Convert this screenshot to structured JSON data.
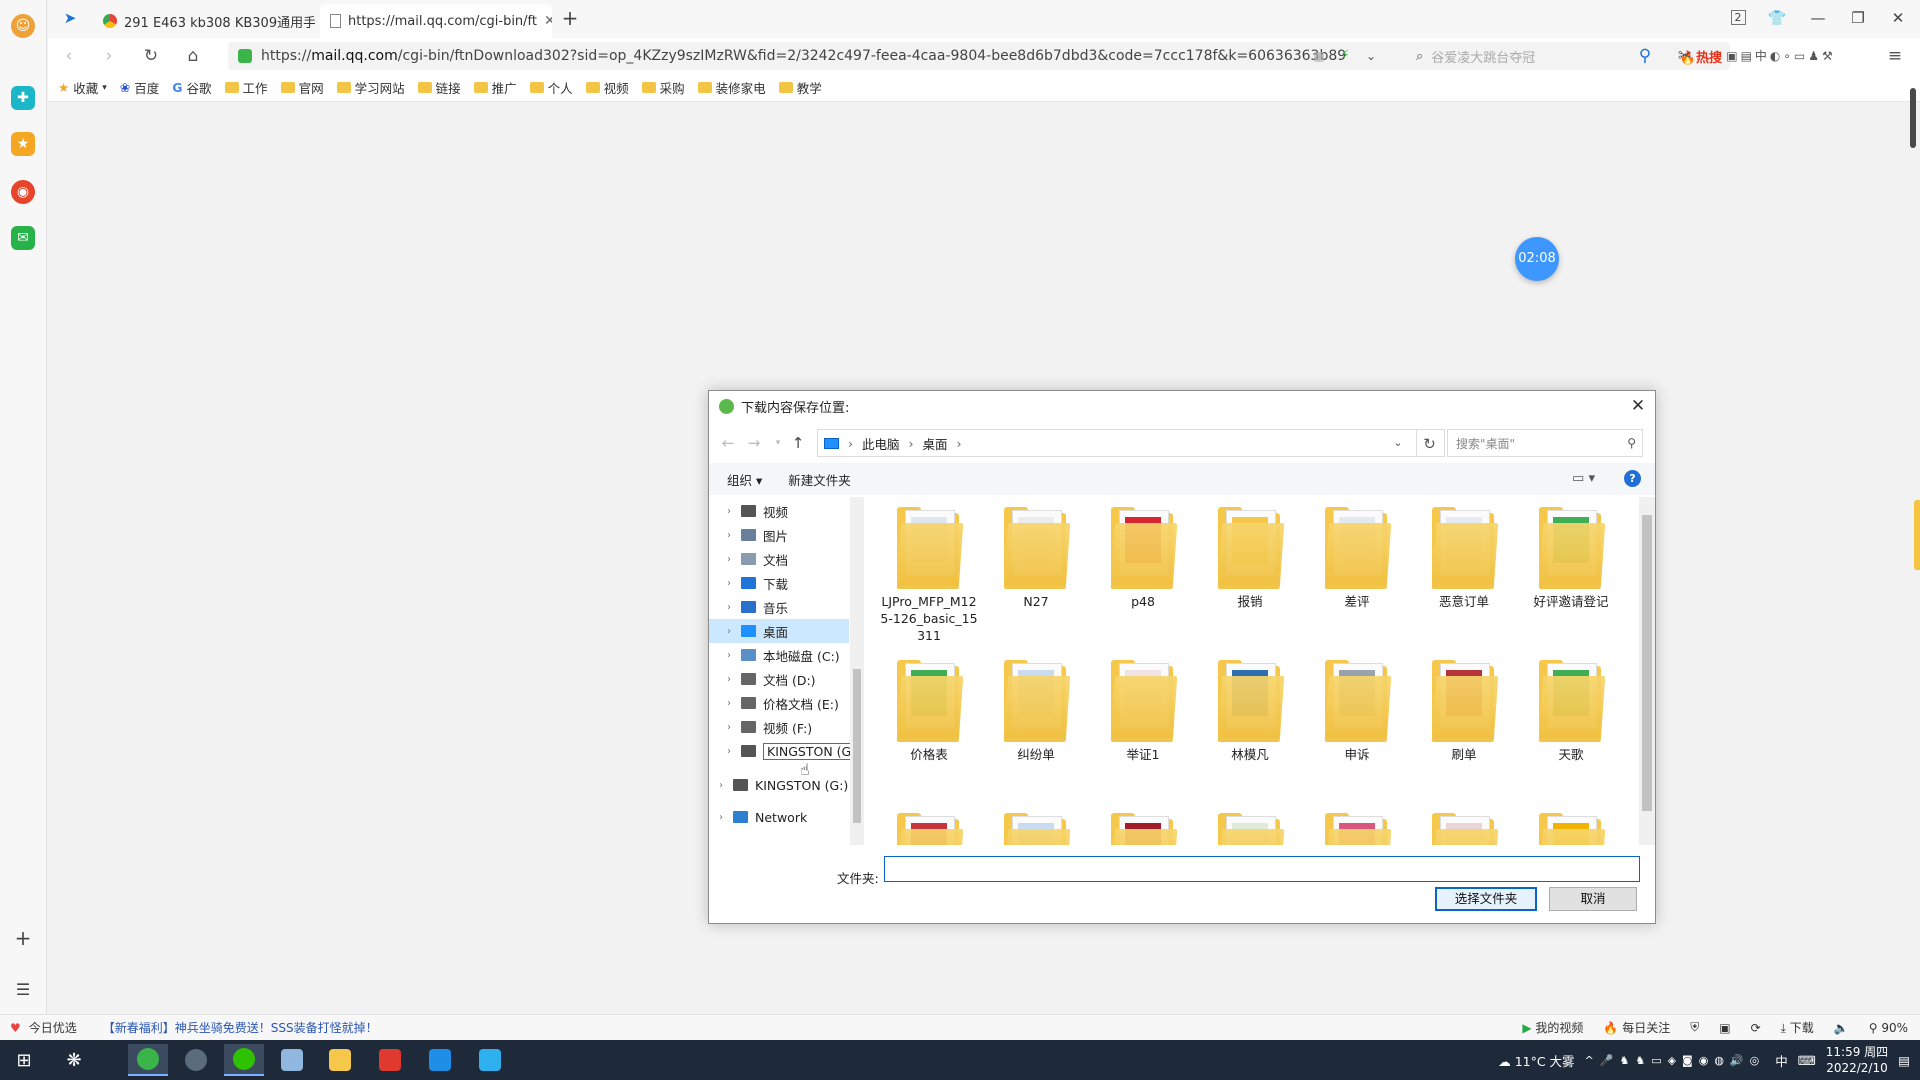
{
  "tabs": [
    {
      "label": "291 E463 kb308 KB309通用手",
      "active": false
    },
    {
      "label": "https://mail.qq.com/cgi-bin/ft",
      "active": true
    }
  ],
  "window": {
    "badge": "2"
  },
  "address": {
    "scheme": "https://",
    "host": "mail.qq.com",
    "path": "/cgi-bin/ftnDownload302?sid=op_4KZzy9szIMzRW&fid=2/3242c497-feea-4caa-9804-bee8d6b7dbd3&code=7ccc178f&k=60636363b89"
  },
  "search": {
    "placeholder": "谷爱凌大跳台夺冠",
    "hot": "🔥热搜"
  },
  "bookmarks": [
    "收藏",
    "百度",
    "谷歌",
    "工作",
    "官网",
    "学习网站",
    "链接",
    "推广",
    "个人",
    "视频",
    "采购",
    "装修家电",
    "教学"
  ],
  "timer": "02:08",
  "dialog": {
    "title": "下载内容保存位置:",
    "breadcrumb": [
      "此电脑",
      "桌面"
    ],
    "search_placeholder": "搜索\"桌面\"",
    "organize": "组织 ▾",
    "new_folder": "新建文件夹",
    "help": "?",
    "tree": [
      {
        "label": "视频",
        "color": "#555555"
      },
      {
        "label": "图片",
        "color": "#6a7f99"
      },
      {
        "label": "文档",
        "color": "#8a9bb0"
      },
      {
        "label": "下载",
        "color": "#1f74d6"
      },
      {
        "label": "音乐",
        "color": "#2a6fc9"
      },
      {
        "label": "桌面",
        "color": "#1e90ff",
        "selected": true
      },
      {
        "label": "本地磁盘 (C:)",
        "color": "#5b8fc7"
      },
      {
        "label": "文档 (D:)",
        "color": "#666666"
      },
      {
        "label": "价格文档 (E:)",
        "color": "#666666"
      },
      {
        "label": "视频 (F:)",
        "color": "#666666"
      },
      {
        "label": "KINGSTON (G:)",
        "color": "#555555",
        "outlined": true
      },
      {
        "label": "KINGSTON (G:)",
        "color": "#555555"
      },
      {
        "label": "Network",
        "color": "#2d7fd0"
      }
    ],
    "files": [
      {
        "name": "LJPro_MFP_M125-126_basic_15311",
        "thumb": "#dfe6ee"
      },
      {
        "name": "N27",
        "thumb": "#ececec"
      },
      {
        "name": "p48",
        "thumb": "#d7262e"
      },
      {
        "name": "报销",
        "thumb": "#f5c84c"
      },
      {
        "name": "差评",
        "thumb": "#e4e9ef"
      },
      {
        "name": "恶意订单",
        "thumb": "#e6ebf2"
      },
      {
        "name": "好评邀请登记",
        "thumb": "#3fae55"
      },
      {
        "name": "价格表",
        "thumb": "#3fae55"
      },
      {
        "name": "纠纷单",
        "thumb": "#c9dcef"
      },
      {
        "name": "举证1",
        "thumb": "#efe3e3"
      },
      {
        "name": "林模凡",
        "thumb": "#2d6fb0"
      },
      {
        "name": "申诉",
        "thumb": "#9aa3ad"
      },
      {
        "name": "刷单",
        "thumb": "#b8343b"
      },
      {
        "name": "天歌",
        "thumb": "#3fae55"
      },
      {
        "name": "",
        "thumb": "#c8343b"
      },
      {
        "name": "",
        "thumb": "#c9dcef"
      },
      {
        "name": "",
        "thumb": "#a31d2a"
      },
      {
        "name": "",
        "thumb": "#dfead9"
      },
      {
        "name": "",
        "thumb": "#d9577a"
      },
      {
        "name": "",
        "thumb": "#e9d4d8"
      },
      {
        "name": "",
        "thumb": "#f0b400"
      }
    ],
    "folder_label": "文件夹:",
    "folder_value": "",
    "select_button": "选择文件夹",
    "cancel_button": "取消"
  },
  "statusbar": {
    "left_label": "今日优选",
    "news": "【新春福利】神兵坐骑免费送！SSS装备打怪就掉！",
    "right_items": [
      "我的视频",
      "每日关注",
      "下载",
      "90%"
    ]
  },
  "taskbar": {
    "weather": "11°C 大雾",
    "ime": "中",
    "time": "11:59 周四",
    "date": "2022/2/10"
  },
  "colors": {
    "accent": "#0a64c8",
    "folder": "#f5c84c",
    "selection": "#cce8ff"
  }
}
